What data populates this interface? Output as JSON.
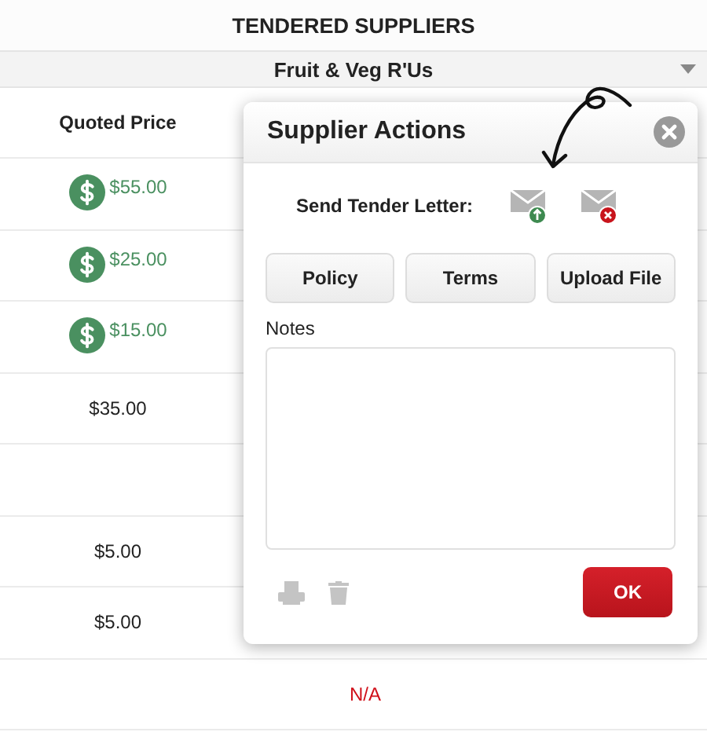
{
  "title": "TENDERED SUPPLIERS",
  "supplier": "Fruit & Veg R'Us",
  "columns": [
    "Quoted Price"
  ],
  "rows": [
    {
      "quoted_price": "$55.00",
      "best": true
    },
    {
      "quoted_price": "$25.00",
      "best": true
    },
    {
      "quoted_price": "$15.00",
      "best": true
    },
    {
      "quoted_price": "$35.00",
      "best": false
    },
    {},
    {
      "quoted_price": "$5.00",
      "best": false
    },
    {
      "quoted_price": "$5.00",
      "best": false
    },
    {
      "column_2": "N/A"
    }
  ],
  "dialog": {
    "title": "Supplier Actions",
    "send_label": "Send Tender Letter:",
    "buttons": [
      "Policy",
      "Terms",
      "Upload File"
    ],
    "notes_label": "Notes",
    "ok": "OK"
  }
}
